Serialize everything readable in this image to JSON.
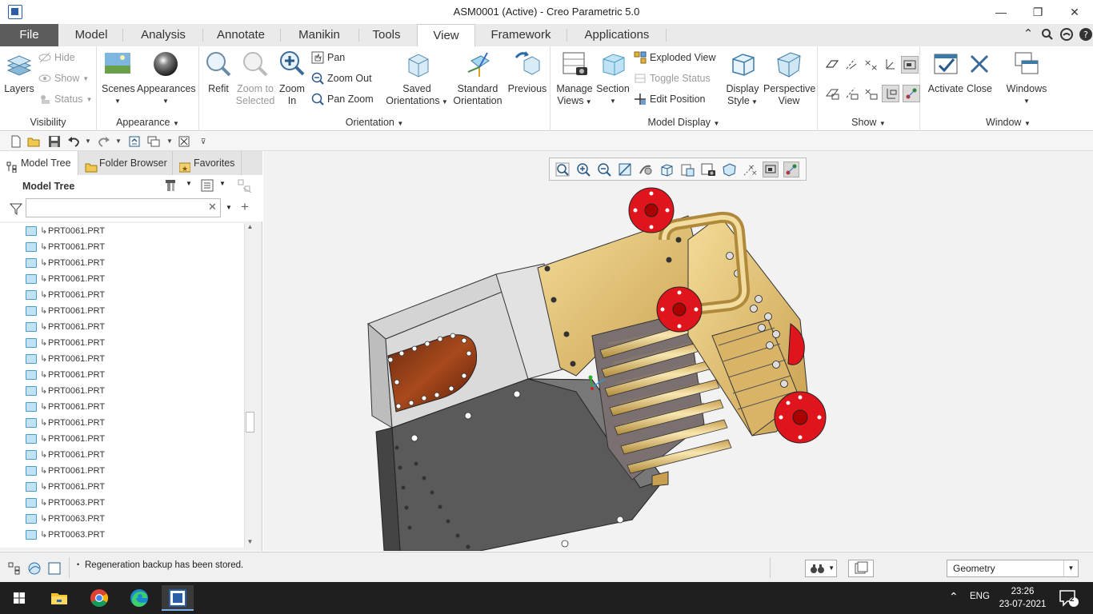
{
  "window": {
    "title": "ASM0001 (Active) - Creo Parametric 5.0",
    "minimize": "—",
    "restore": "❐",
    "close": "✕"
  },
  "tabs": [
    {
      "label": "File"
    },
    {
      "label": "Model"
    },
    {
      "label": "Analysis"
    },
    {
      "label": "Annotate"
    },
    {
      "label": "Manikin"
    },
    {
      "label": "Tools"
    },
    {
      "label": "View"
    },
    {
      "label": "Framework"
    },
    {
      "label": "Applications"
    }
  ],
  "ribbon": {
    "visibility": {
      "label": "Visibility",
      "layers": "Layers",
      "hide": "Hide",
      "show": "Show",
      "status": "Status"
    },
    "appearance": {
      "label": "Appearance",
      "scenes": "Scenes",
      "appearances": "Appearances"
    },
    "orientation": {
      "label": "Orientation",
      "refit": "Refit",
      "zoom_to_selected_1": "Zoom to",
      "zoom_to_selected_2": "Selected",
      "zoom_in_1": "Zoom",
      "zoom_in_2": "In",
      "pan": "Pan",
      "zoom_out": "Zoom Out",
      "pan_zoom": "Pan Zoom",
      "saved_1": "Saved",
      "saved_2": "Orientations",
      "standard_1": "Standard",
      "standard_2": "Orientation",
      "previous": "Previous"
    },
    "model_display": {
      "label": "Model Display",
      "manage_1": "Manage",
      "manage_2": "Views",
      "section": "Section",
      "exploded": "Exploded View",
      "toggle_status": "Toggle Status",
      "edit_position": "Edit Position",
      "display_1": "Display",
      "display_2": "Style",
      "perspective_1": "Perspective",
      "perspective_2": "View"
    },
    "show": {
      "label": "Show"
    },
    "window": {
      "label": "Window",
      "activate": "Activate",
      "close": "Close",
      "windows": "Windows"
    }
  },
  "left_panel": {
    "tabs": [
      {
        "label": "Model Tree"
      },
      {
        "label": "Folder Browser"
      },
      {
        "label": "Favorites"
      }
    ],
    "header": "Model Tree",
    "filter_placeholder": "",
    "items": [
      "PRT0061.PRT",
      "PRT0061.PRT",
      "PRT0061.PRT",
      "PRT0061.PRT",
      "PRT0061.PRT",
      "PRT0061.PRT",
      "PRT0061.PRT",
      "PRT0061.PRT",
      "PRT0061.PRT",
      "PRT0061.PRT",
      "PRT0061.PRT",
      "PRT0061.PRT",
      "PRT0061.PRT",
      "PRT0061.PRT",
      "PRT0061.PRT",
      "PRT0061.PRT",
      "PRT0061.PRT",
      "PRT0063.PRT",
      "PRT0063.PRT",
      "PRT0063.PRT"
    ]
  },
  "status": {
    "message": "Regeneration backup has been stored.",
    "filter": "Geometry"
  },
  "taskbar": {
    "lang": "ENG",
    "time": "23:26",
    "date": "23-07-2021",
    "notifications": "2"
  },
  "colors": {
    "file_tab": "#5c5c5c",
    "flange_red": "#e0141c",
    "brass": "#e6c36a",
    "steel": "#6e6e6e"
  }
}
